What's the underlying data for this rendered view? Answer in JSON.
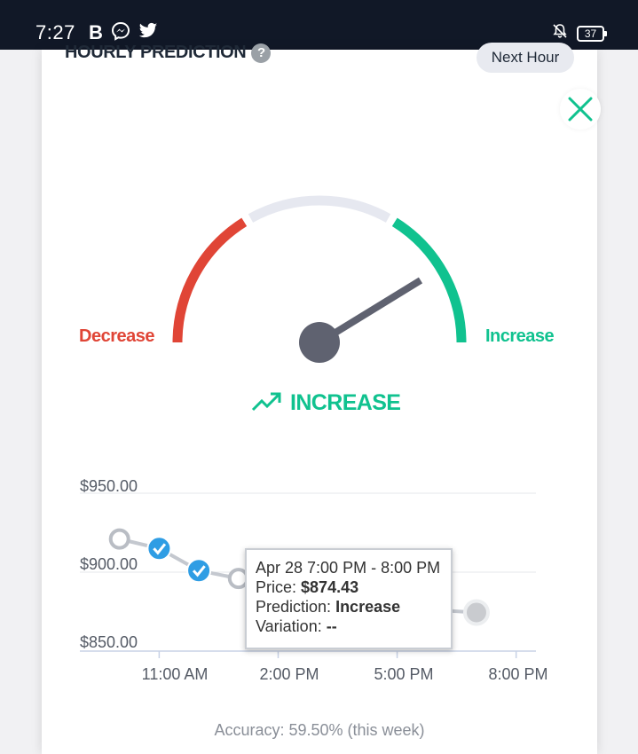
{
  "status_bar": {
    "time": "7:27",
    "left_icons": [
      "B",
      "messenger-icon",
      "twitter-icon"
    ],
    "battery": "37"
  },
  "card": {
    "title": "HOURLY PREDICTION",
    "period_pill": "Next Hour"
  },
  "gauge": {
    "label_decrease": "Decrease",
    "label_increase": "Increase",
    "result": "INCREASE",
    "colors": {
      "decrease": "#e04536",
      "neutral": "#e6e8f0",
      "increase": "#10c28f",
      "needle": "#5f6270"
    }
  },
  "chart_data": {
    "type": "line",
    "y_ticks": [
      "$950.00",
      "$900.00",
      "$850.00"
    ],
    "x_ticks": [
      "11:00 AM",
      "2:00 PM",
      "5:00 PM",
      "8:00 PM"
    ],
    "ylim": [
      850,
      950
    ],
    "series": [
      {
        "points": [
          {
            "x": 10.0,
            "y": 921,
            "status": "gray"
          },
          {
            "x": 11.0,
            "y": 915,
            "status": "correct"
          },
          {
            "x": 12.0,
            "y": 901,
            "status": "correct"
          },
          {
            "x": 13.0,
            "y": 896,
            "status": "gray"
          },
          {
            "x": 14.0,
            "y": 891,
            "status": "correct"
          },
          {
            "x": 15.0,
            "y": 877,
            "status": "gray"
          },
          {
            "x": 16.0,
            "y": 884,
            "status": "correct"
          },
          {
            "x": 17.0,
            "y": 885,
            "status": "gray"
          },
          {
            "x": 18.0,
            "y": 876,
            "status": "gray"
          },
          {
            "x": 19.0,
            "y": 874.43,
            "status": "current"
          }
        ]
      }
    ],
    "x_tick_values": [
      11,
      14,
      17,
      20
    ],
    "x_range": [
      9.0,
      20.5
    ],
    "grid": true,
    "colors": {
      "line": "#c4c8cf",
      "correct": "#2f9de4",
      "gray": "#b9bdc4",
      "grid": "#e5e7eb",
      "axis": "#c8d2e6"
    }
  },
  "tooltip": {
    "date_range": "Apr 28 7:00 PM - 8:00 PM",
    "price_label": "Price:",
    "price_value": "$874.43",
    "prediction_label": "Prediction:",
    "prediction_value": "Increase",
    "variation_label": "Variation:",
    "variation_value": "--"
  },
  "footer": {
    "accuracy": "Accuracy: 59.50% (this week)"
  }
}
